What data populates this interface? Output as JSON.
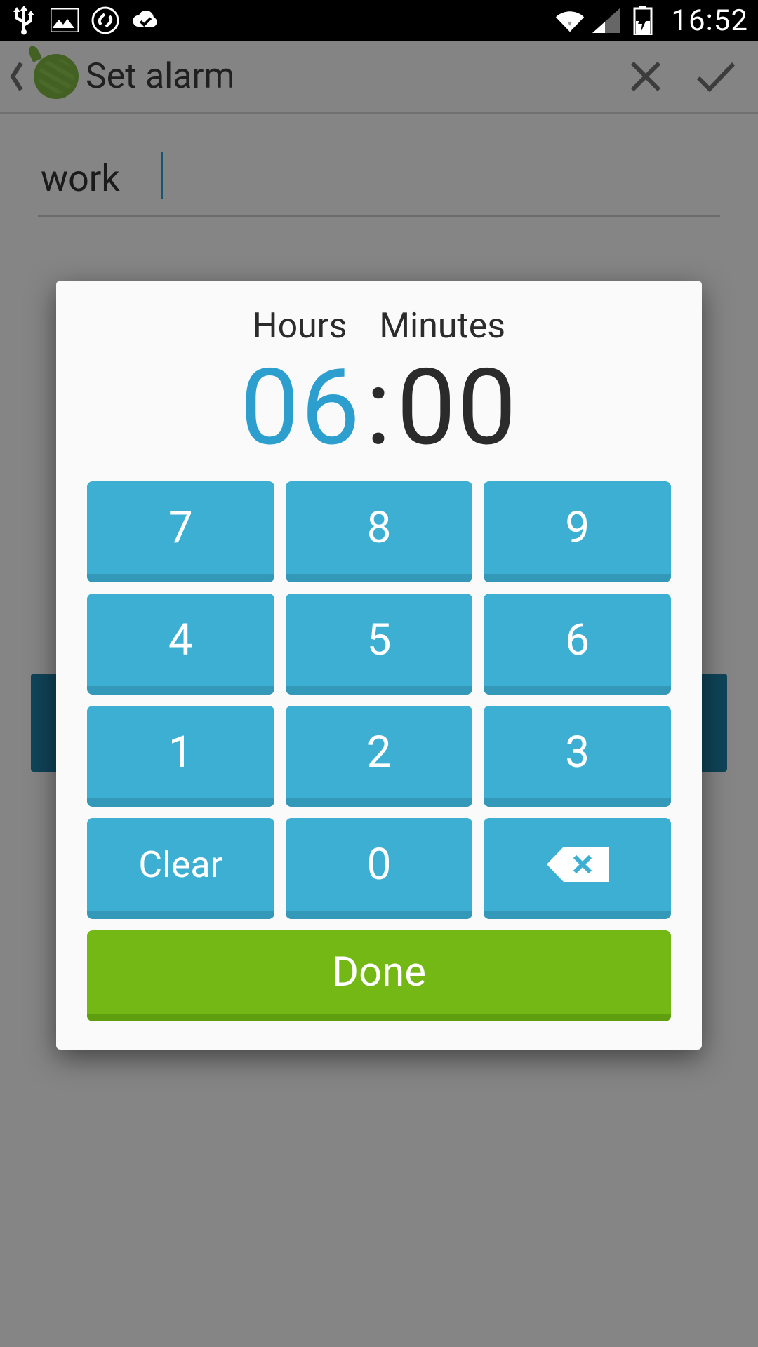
{
  "status_bar": {
    "time": "16:52"
  },
  "header": {
    "title": "Set alarm"
  },
  "content": {
    "alarm_name": "work"
  },
  "modal": {
    "hours_label": "Hours",
    "minutes_label": "Minutes",
    "hours_value": "06",
    "minutes_value": "00",
    "keys": {
      "r1c1": "7",
      "r1c2": "8",
      "r1c3": "9",
      "r2c1": "4",
      "r2c2": "5",
      "r2c3": "6",
      "r3c1": "1",
      "r3c2": "2",
      "r3c3": "3",
      "clear": "Clear",
      "zero": "0"
    },
    "done_label": "Done"
  },
  "colors": {
    "accent_blue": "#2c9fcf",
    "key_blue": "#3cafd2",
    "done_green": "#74b816"
  }
}
